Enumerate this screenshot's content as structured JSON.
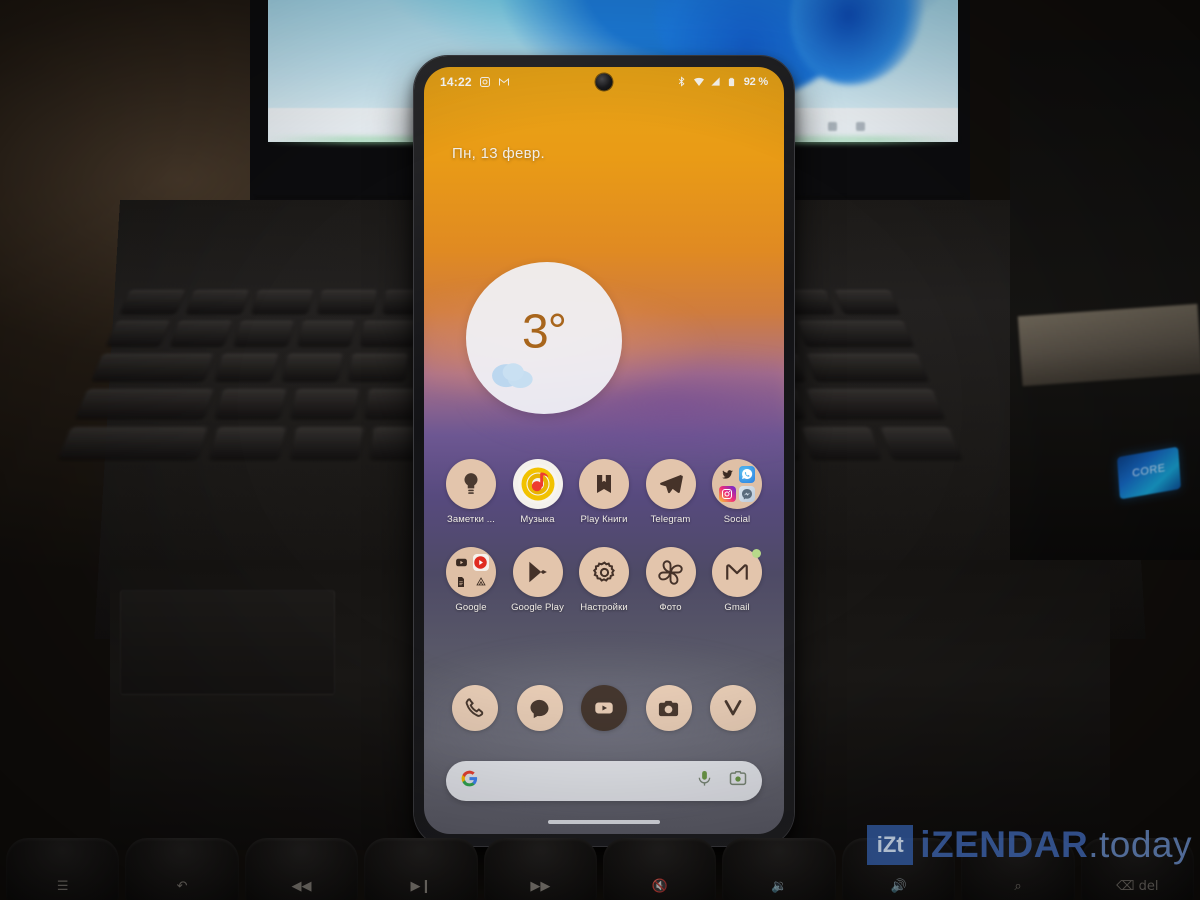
{
  "scene": {
    "description": "Google Pixel phone standing in front of a dark laptop showing a Windows 11 desktop",
    "laptop_sticker": "CORE"
  },
  "phone": {
    "statusbar": {
      "time": "14:22",
      "left_icons": [
        "screenshot-icon",
        "gmail-icon"
      ],
      "right_icons": [
        "bluetooth-icon",
        "wifi-icon",
        "signal-icon",
        "battery-icon"
      ],
      "battery_percent": "92 %"
    },
    "date": "Пн, 13 февр.",
    "weather": {
      "temperature": "3°",
      "condition_icon": "cloud-icon",
      "temp_color": "#a8651c"
    },
    "app_rows": [
      {
        "apps": [
          {
            "label": "Заметки ...",
            "icon": "keep-notes-icon",
            "type": "app"
          },
          {
            "label": "Музыка",
            "icon": "yandex-music-icon",
            "type": "app"
          },
          {
            "label": "Play Книги",
            "icon": "play-books-icon",
            "type": "app"
          },
          {
            "label": "Telegram",
            "icon": "telegram-icon",
            "type": "app"
          },
          {
            "label": "Social",
            "icon": "folder-icon",
            "type": "folder",
            "contents": [
              "twitter-icon",
              "whatsapp-icon",
              "instagram-icon",
              "messenger-icon"
            ]
          }
        ]
      },
      {
        "apps": [
          {
            "label": "Google",
            "icon": "folder-icon",
            "type": "folder",
            "contents": [
              "youtube-icon",
              "youtube-music-icon",
              "docs-icon",
              "drive-icon"
            ]
          },
          {
            "label": "Google Play",
            "icon": "play-store-icon",
            "type": "app"
          },
          {
            "label": "Настройки",
            "icon": "settings-gear-icon",
            "type": "app"
          },
          {
            "label": "Фото",
            "icon": "google-photos-icon",
            "type": "app"
          },
          {
            "label": "Gmail",
            "icon": "gmail-icon",
            "type": "app",
            "badge": true
          }
        ]
      }
    ],
    "dock": [
      {
        "icon": "phone-icon",
        "label": "Phone"
      },
      {
        "icon": "messages-icon",
        "label": "Messages"
      },
      {
        "icon": "youtube-icon",
        "label": "YouTube"
      },
      {
        "icon": "camera-icon",
        "label": "Camera"
      },
      {
        "icon": "vivaldi-icon",
        "label": "Vivaldi"
      }
    ],
    "search": {
      "leading_icon": "google-g-icon",
      "placeholder": "",
      "value": "",
      "mic_icon": "microphone-icon",
      "lens_icon": "google-lens-icon"
    },
    "navigation": "home-gesture-pill"
  },
  "keyboard": {
    "function_keys": [
      "☰",
      "↶",
      "◀◀",
      "▶❙",
      "▶▶",
      "🔇",
      "🔉",
      "🔊",
      "⌕",
      "⌫ del"
    ]
  },
  "watermark": {
    "badge": "iZt",
    "name": "iZENDAR",
    "suffix": ".today",
    "color_primary": "#3a5fa5",
    "color_secondary": "#5f7fb5"
  }
}
